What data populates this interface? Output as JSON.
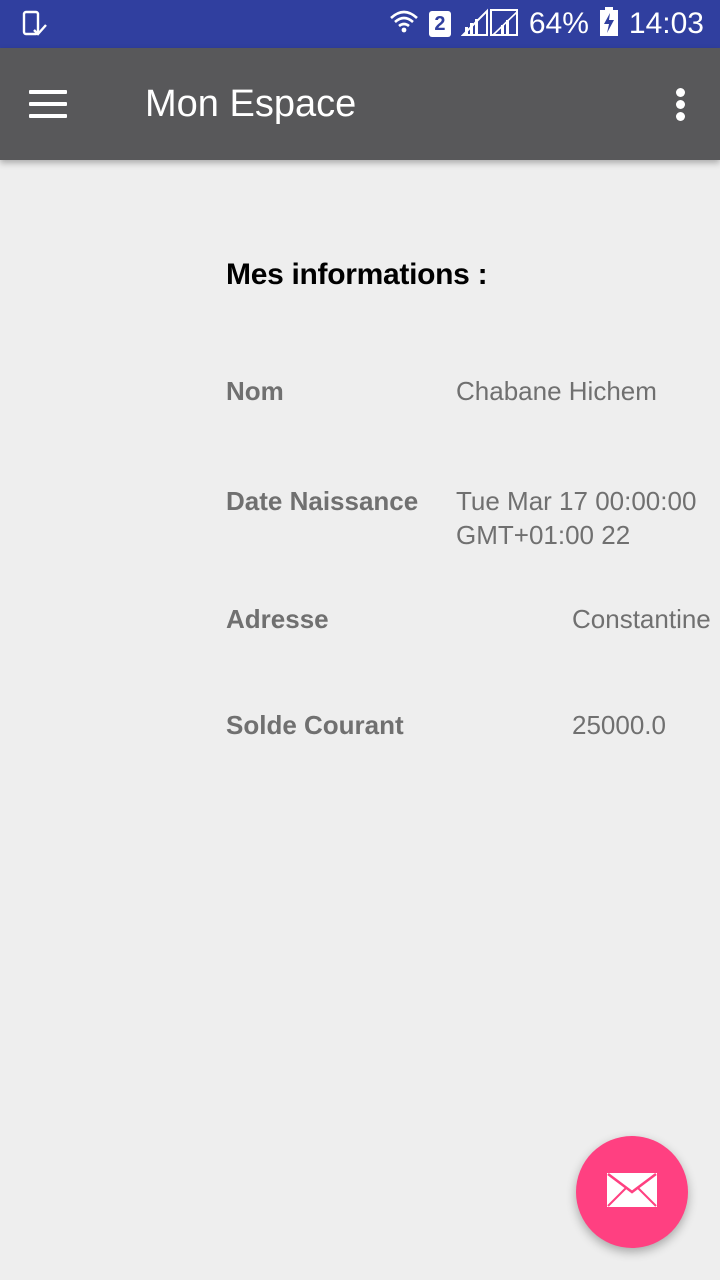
{
  "status_bar": {
    "left_icon": "phone-check-icon",
    "battery_percent": "64%",
    "time": "14:03",
    "sim_number": "2",
    "icons": [
      "wifi-icon",
      "sim-2-icon",
      "signal-icon",
      "signal-icon",
      "battery-charging-icon"
    ]
  },
  "app_bar": {
    "title": "Mon Espace",
    "menu_icon": "hamburger-menu-icon",
    "overflow_icon": "more-vert-icon",
    "background_color": "#58585a"
  },
  "content": {
    "section_title": "Mes informations :",
    "fields": {
      "nom": {
        "label": "Nom",
        "value": "Chabane Hichem"
      },
      "date_naissance": {
        "label": "Date Naissance",
        "value_line1": "Tue Mar 17 00:00:00",
        "value_line2": "GMT+01:00 22"
      },
      "adresse": {
        "label": "Adresse",
        "value": "Constantine"
      },
      "solde": {
        "label": "Solde Courant",
        "value": "25000.0"
      }
    }
  },
  "fab": {
    "icon": "mail-envelope-icon",
    "color": "#ff4081"
  },
  "colors": {
    "status_bar": "#303f9f",
    "background": "#eeeeee",
    "label_text": "#707070"
  }
}
